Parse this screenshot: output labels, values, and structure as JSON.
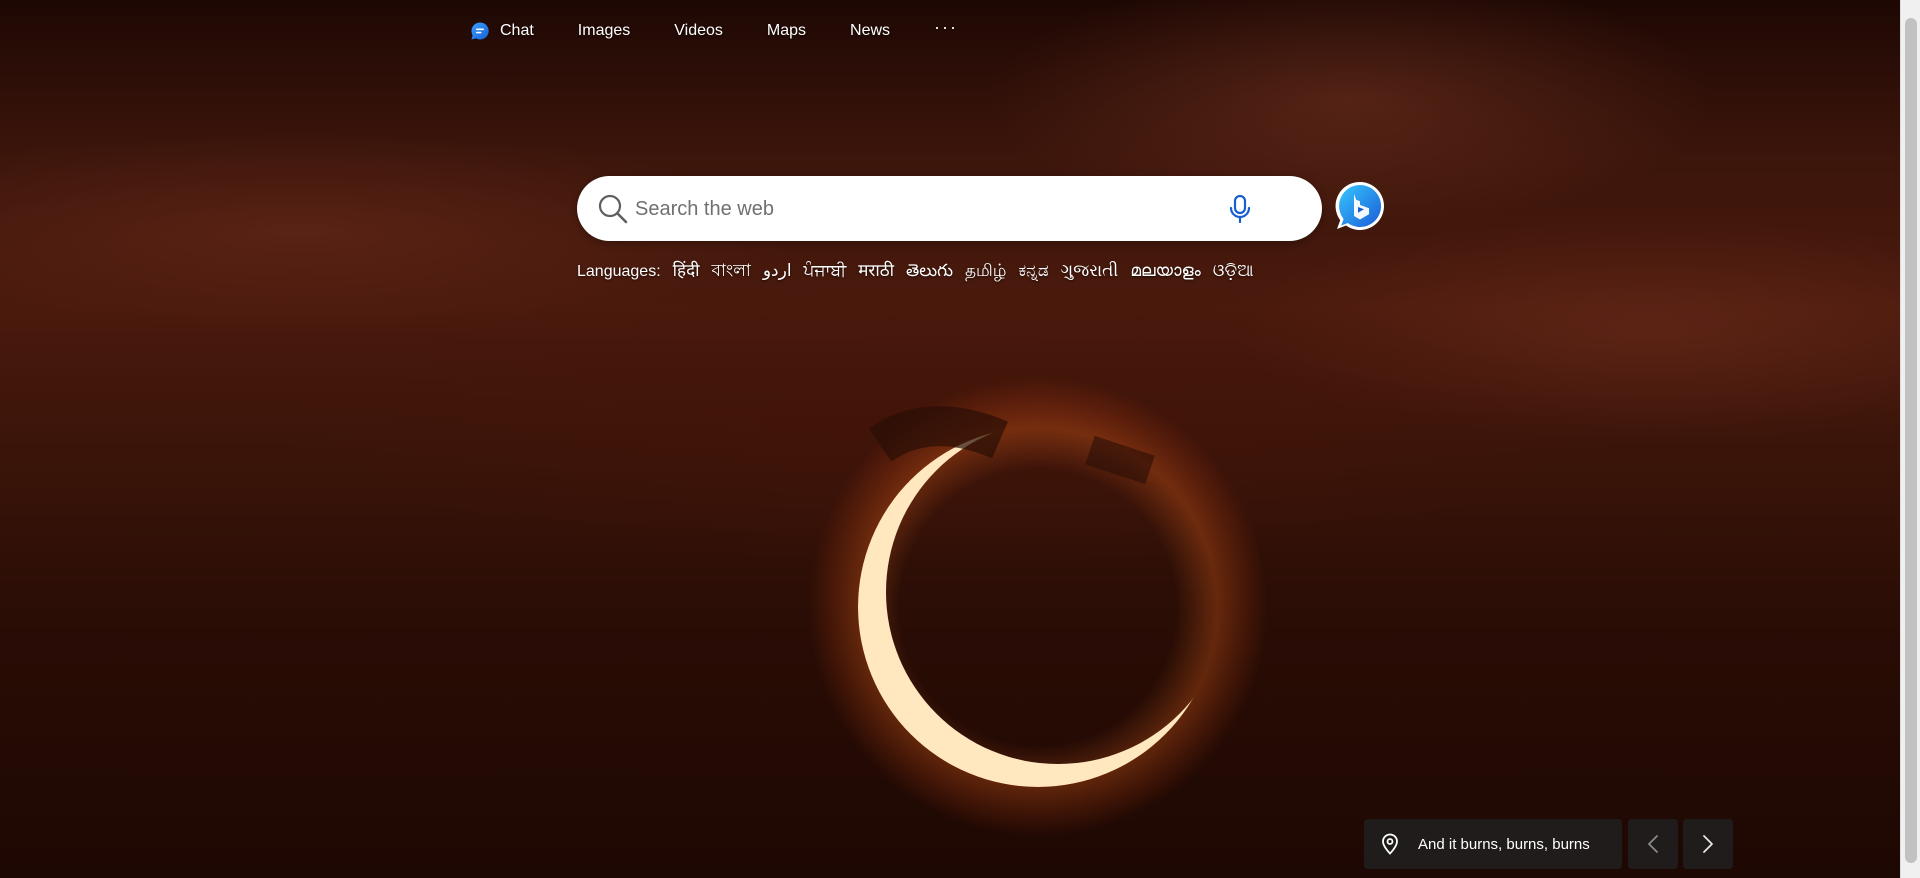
{
  "nav": {
    "items": [
      {
        "label": "Chat",
        "icon": "chat-bubble-icon"
      },
      {
        "label": "Images"
      },
      {
        "label": "Videos"
      },
      {
        "label": "Maps"
      },
      {
        "label": "News"
      }
    ],
    "more_label": "···"
  },
  "search": {
    "placeholder": "Search the web",
    "value": ""
  },
  "languages": {
    "label": "Languages:",
    "items": [
      "हिंदी",
      "বাংলা",
      "اردو",
      "ਪੰਜਾਬੀ",
      "मराठी",
      "తెలుగు",
      "தமிழ்",
      "ಕನ್ನಡ",
      "ગુજરાતી",
      "മലയാളം",
      "ଓଡ଼ିଆ"
    ]
  },
  "caption": {
    "text": "And it burns, burns, burns",
    "icon": "location-pin-icon"
  },
  "colors": {
    "accent": "#0067b8",
    "ring": "#ffd9a0"
  }
}
